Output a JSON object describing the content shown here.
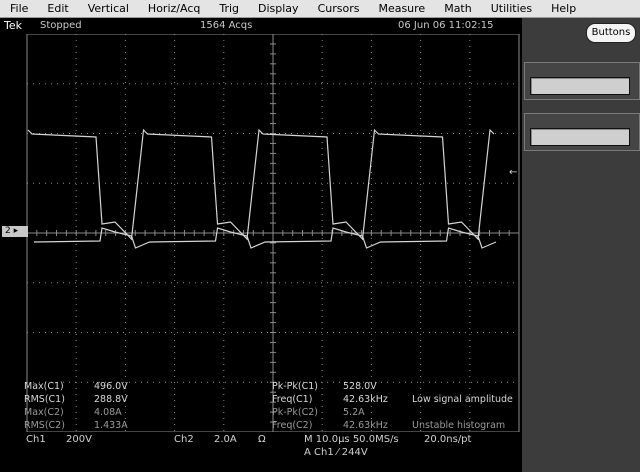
{
  "menu": {
    "items": [
      "File",
      "Edit",
      "Vertical",
      "Horiz/Acq",
      "Trig",
      "Display",
      "Cursors",
      "Measure",
      "Math",
      "Utilities",
      "Help"
    ]
  },
  "status": {
    "brand": "Tek",
    "acq_state": "Stopped",
    "acq_count": "1564 Acqs",
    "datetime": "06 Jun 06 11:02:15"
  },
  "panel": {
    "buttons_label": "Buttons"
  },
  "markers": {
    "ch2": "2 ▸",
    "trigger": "←"
  },
  "measurements": {
    "max_c1": {
      "label": "Max(C1)",
      "value": "496.0V"
    },
    "rms_c1": {
      "label": "RMS(C1)",
      "value": "288.8V"
    },
    "max_c2": {
      "label": "Max(C2)",
      "value": "4.08A"
    },
    "rms_c2": {
      "label": "RMS(C2)",
      "value": "1.433A"
    },
    "pkpk_c1": {
      "label": "Pk-Pk(C1)",
      "value": "528.0V"
    },
    "freq_c1": {
      "label": "Freq(C1)",
      "value": "42.63kHz",
      "note": "Low signal amplitude"
    },
    "pkpk_c2": {
      "label": "Pk-Pk(C2)",
      "value": "5.2A"
    },
    "freq_c2": {
      "label": "Freq(C2)",
      "value": "42.63kHz",
      "note": "Unstable histogram"
    }
  },
  "bottom": {
    "ch1_label": "Ch1",
    "ch1_scale": "200V",
    "ch2_label": "Ch2",
    "ch2_scale": "2.0A",
    "ch2_unit": "Ω",
    "timebase": "M 10.0µs 50.0MS/s",
    "resolution": "20.0ns/pt",
    "trigger": "A  Ch1  ⁄  244V"
  },
  "colors": {
    "trace": "#d4d4d4",
    "grid": "#8a8a8a",
    "background": "#000000"
  }
}
